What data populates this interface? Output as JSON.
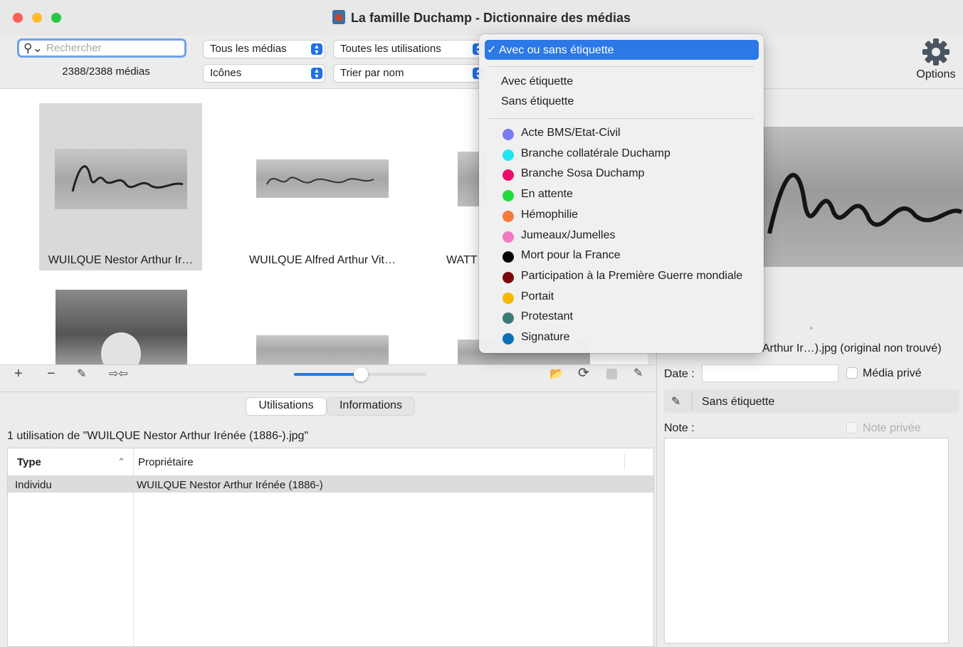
{
  "window": {
    "title": "La famille Duchamp - Dictionnaire des médias"
  },
  "toolbar": {
    "search_placeholder": "Rechercher",
    "media_count": "2388/2388 médias",
    "media_filter": "Tous les médias",
    "usage_filter": "Toutes les utilisations",
    "view_mode": "Icônes",
    "sort": "Trier par nom",
    "options_label": "Options"
  },
  "grid": {
    "items": [
      {
        "caption": "WUILQUE Nestor Arthur Ir…",
        "selected": true
      },
      {
        "caption": "WUILQUE Alfred Arthur Vit…",
        "selected": false
      },
      {
        "caption": "WATT",
        "selected": false
      }
    ]
  },
  "gridbar": {
    "add": "+",
    "remove": "−",
    "zoom_percent": 50
  },
  "tabs": [
    {
      "label": "Utilisations",
      "selected": true
    },
    {
      "label": "Informations",
      "selected": false
    }
  ],
  "uses": {
    "summary": "1 utilisation de \"WUILQUE Nestor Arthur Irénée (1886-).jpg\"",
    "columns": [
      "Type",
      "Propriétaire"
    ],
    "rows": [
      {
        "type": "Individu",
        "owner": "WUILQUE Nestor Arthur Irénée (1886-)"
      }
    ]
  },
  "details": {
    "filename": "Arthur Ir…).jpg (original non trouvé)",
    "date_label": "Date :",
    "private_media_label": "Média privé",
    "tag_value": "Sans étiquette",
    "note_label": "Note :",
    "private_note_label": "Note privée"
  },
  "tag_menu": {
    "selected": "Avec ou sans étiquette",
    "options": [
      "Avec étiquette",
      "Sans étiquette"
    ],
    "tags": [
      {
        "label": "Acte BMS/Etat-Civil",
        "color": "#7b7cf0"
      },
      {
        "label": "Branche collatérale Duchamp",
        "color": "#1ee6f2"
      },
      {
        "label": "Branche Sosa Duchamp",
        "color": "#ef0a6b"
      },
      {
        "label": "En attente",
        "color": "#22dc3f"
      },
      {
        "label": "Hémophilie",
        "color": "#f47a3c"
      },
      {
        "label": "Jumeaux/Jumelles",
        "color": "#f27ac0"
      },
      {
        "label": "Mort pour la France",
        "color": "#050505"
      },
      {
        "label": "Participation à la Première Guerre mondiale",
        "color": "#7a0a0a"
      },
      {
        "label": "Portait",
        "color": "#f5b800"
      },
      {
        "label": "Protestant",
        "color": "#3e7a78"
      },
      {
        "label": "Signature",
        "color": "#0b72b8"
      }
    ]
  }
}
